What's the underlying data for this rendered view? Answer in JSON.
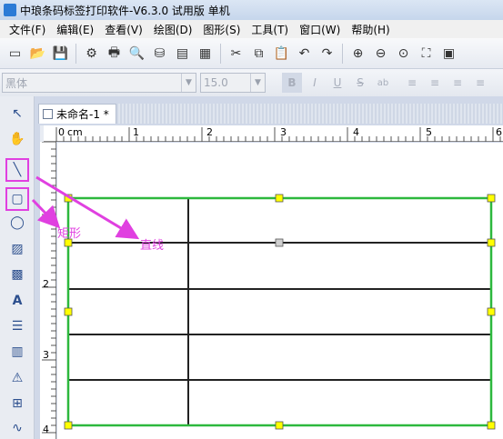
{
  "window": {
    "title": "中琅条码标签打印软件-V6.3.0 试用版 单机"
  },
  "menu": [
    "文件(F)",
    "编辑(E)",
    "查看(V)",
    "绘图(D)",
    "图形(S)",
    "工具(T)",
    "窗口(W)",
    "帮助(H)"
  ],
  "font_toolbar": {
    "font_name": "黑体",
    "font_size": "15.0",
    "bold": "B",
    "italic": "I",
    "underline": "U",
    "strike": "S",
    "special": "ab"
  },
  "document": {
    "tab_title": "未命名-1 *"
  },
  "ruler": {
    "unit": "cm",
    "top_labels": [
      "0",
      "1",
      "2",
      "3",
      "4",
      "5",
      "6"
    ],
    "left_labels": [
      "2",
      "3",
      "4"
    ]
  },
  "annotations": {
    "rect_label": "矩形",
    "line_label": "直线"
  },
  "colors": {
    "highlight": "#e040e0",
    "selection": "#2db83d",
    "handle": "#ffff00"
  }
}
